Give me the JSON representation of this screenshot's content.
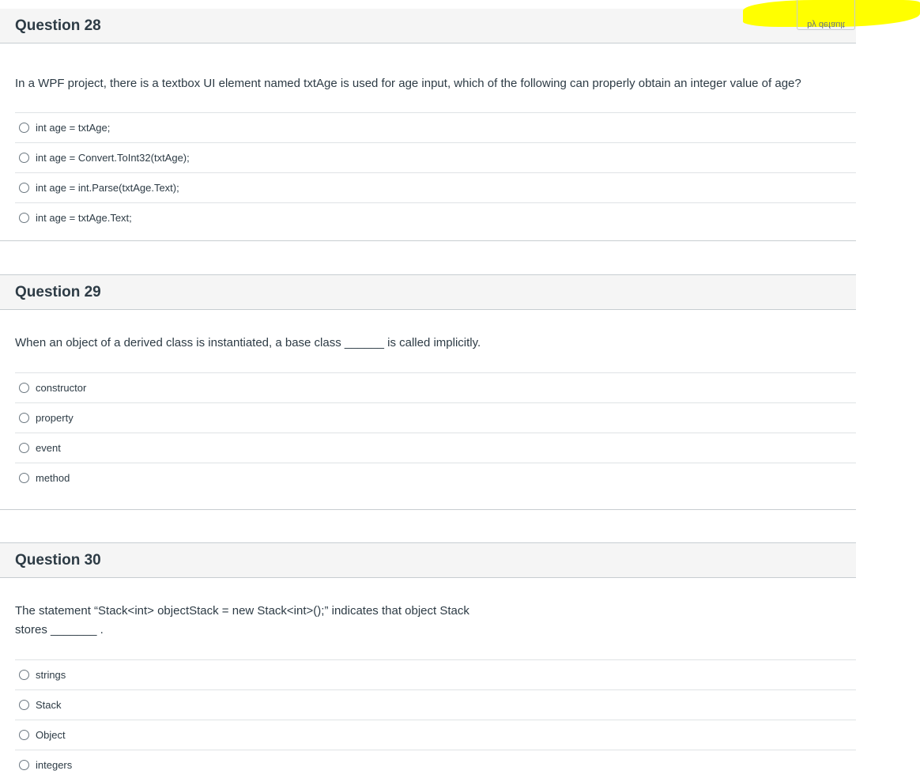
{
  "tooltip": {
    "text": "by default"
  },
  "questions": [
    {
      "title": "Question 28",
      "text": "In a WPF project, there is a textbox UI element named txtAge is used for age input, which of the following can properly obtain an integer value of age?",
      "answers": [
        "int age = txtAge;",
        "int age = Convert.ToInt32(txtAge);",
        "int age = int.Parse(txtAge.Text);",
        "int age = txtAge.Text;"
      ]
    },
    {
      "title": "Question 29",
      "text": "When an object of a derived class is instantiated, a base class ______ is called implicitly.",
      "answers": [
        "constructor",
        "property",
        "event",
        "method"
      ]
    },
    {
      "title": "Question 30",
      "text": "The statement “Stack<int> objectStack = new Stack<int>();” indicates that object Stack stores _______ .",
      "answers": [
        "strings",
        "Stack",
        "Object",
        "integers"
      ]
    }
  ]
}
